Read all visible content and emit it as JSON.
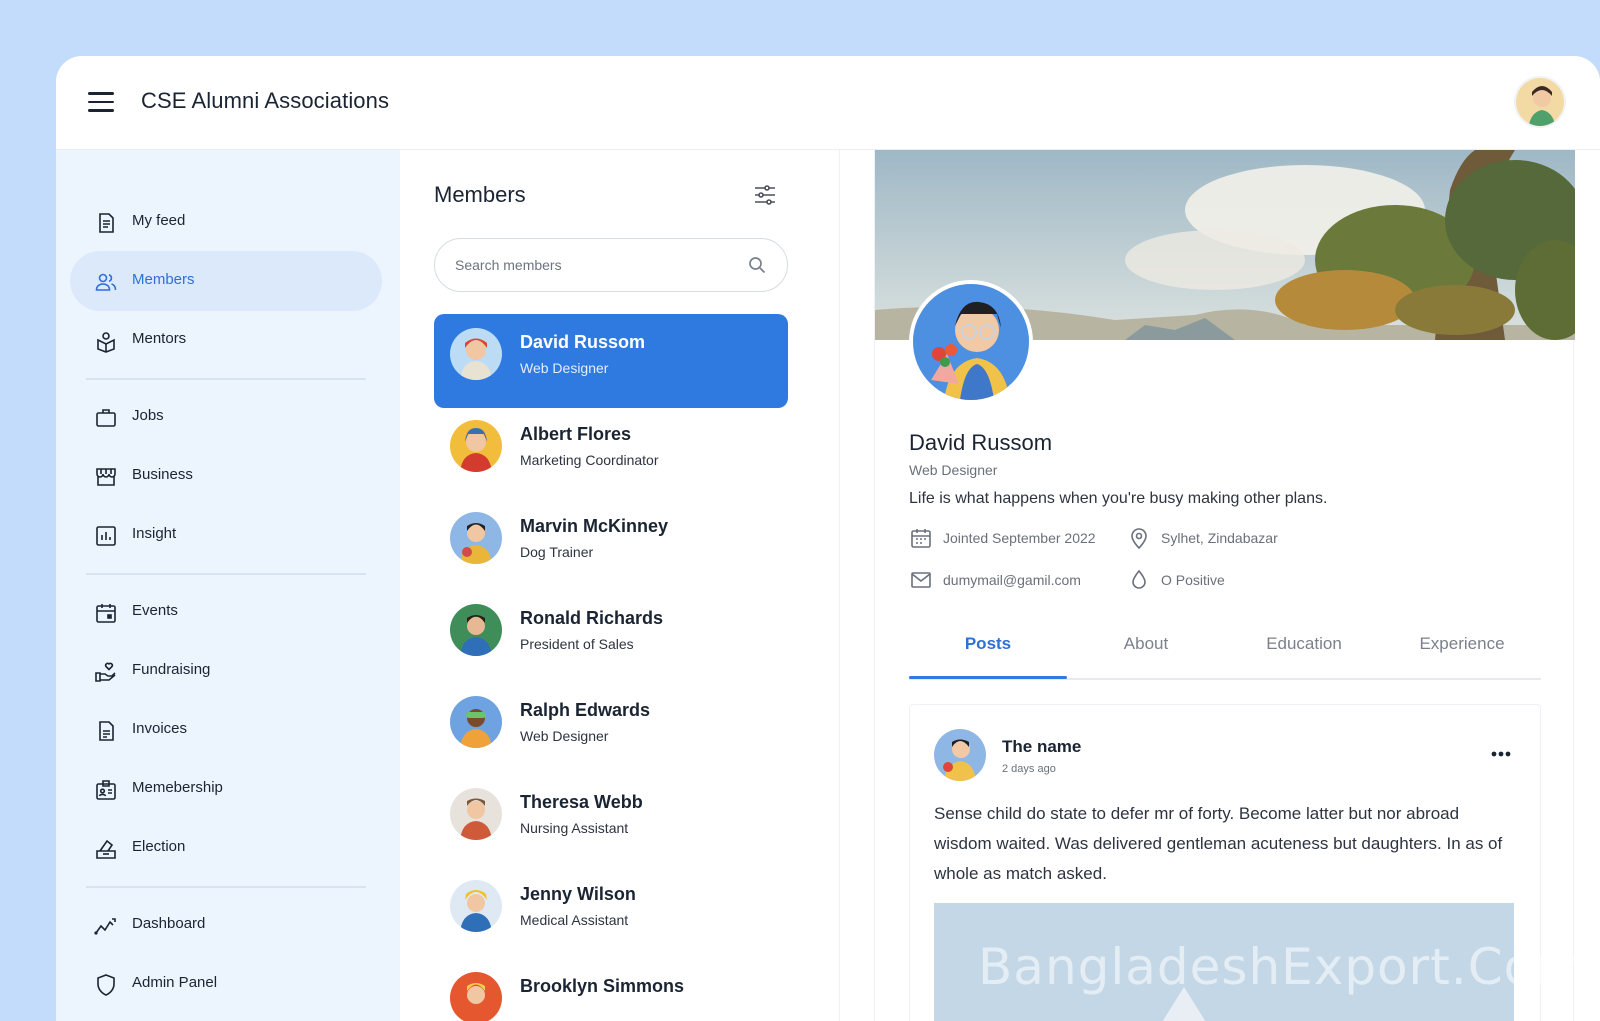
{
  "app": {
    "title": "CSE Alumni Associations"
  },
  "sidebar": {
    "items": [
      {
        "label": "My feed",
        "icon": "document-icon"
      },
      {
        "label": "Members",
        "icon": "users-icon",
        "active": true
      },
      {
        "label": "Mentors",
        "icon": "mentor-icon"
      },
      {
        "label": "Jobs",
        "icon": "briefcase-icon"
      },
      {
        "label": "Business",
        "icon": "store-icon"
      },
      {
        "label": "Insight",
        "icon": "bar-chart-icon"
      },
      {
        "label": "Events",
        "icon": "calendar-icon"
      },
      {
        "label": "Fundraising",
        "icon": "hand-heart-icon"
      },
      {
        "label": "Invoices",
        "icon": "invoice-icon"
      },
      {
        "label": "Memebership",
        "icon": "id-card-icon"
      },
      {
        "label": "Election",
        "icon": "ballot-icon"
      },
      {
        "label": "Dashboard",
        "icon": "trend-icon"
      },
      {
        "label": "Admin Panel",
        "icon": "shield-icon"
      }
    ]
  },
  "members": {
    "title": "Members",
    "search_placeholder": "Search members",
    "list": [
      {
        "name": "David Russom",
        "role": "Web Designer",
        "active": true
      },
      {
        "name": "Albert Flores",
        "role": "Marketing Coordinator"
      },
      {
        "name": "Marvin McKinney",
        "role": "Dog Trainer"
      },
      {
        "name": "Ronald Richards",
        "role": "President of Sales"
      },
      {
        "name": "Ralph Edwards",
        "role": "Web Designer"
      },
      {
        "name": "Theresa Webb",
        "role": "Nursing Assistant"
      },
      {
        "name": "Jenny Wilson",
        "role": "Medical Assistant"
      },
      {
        "name": "Brooklyn Simmons",
        "role": ""
      }
    ]
  },
  "profile": {
    "name": "David Russom",
    "role": "Web Designer",
    "bio": "Life is what happens when you're busy making other plans.",
    "joined": "Jointed September 2022",
    "location": "Sylhet, Zindabazar",
    "email": "dumymail@gamil.com",
    "blood": "O Positive",
    "tabs": [
      "Posts",
      "About",
      "Education",
      "Experience"
    ],
    "active_tab": "Posts"
  },
  "post": {
    "author": "The name",
    "time": "2 days ago",
    "text": "Sense child do state to defer mr of forty. Become latter but nor abroad wisdom waited. Was delivered gentleman acuteness but daughters. In as of whole as match asked."
  },
  "watermark": "BangladeshExport.Com",
  "colors": {
    "accent": "#2f7ae0",
    "sidebar_bg": "#ecf4fe",
    "page_bg": "#c3dcfb"
  }
}
